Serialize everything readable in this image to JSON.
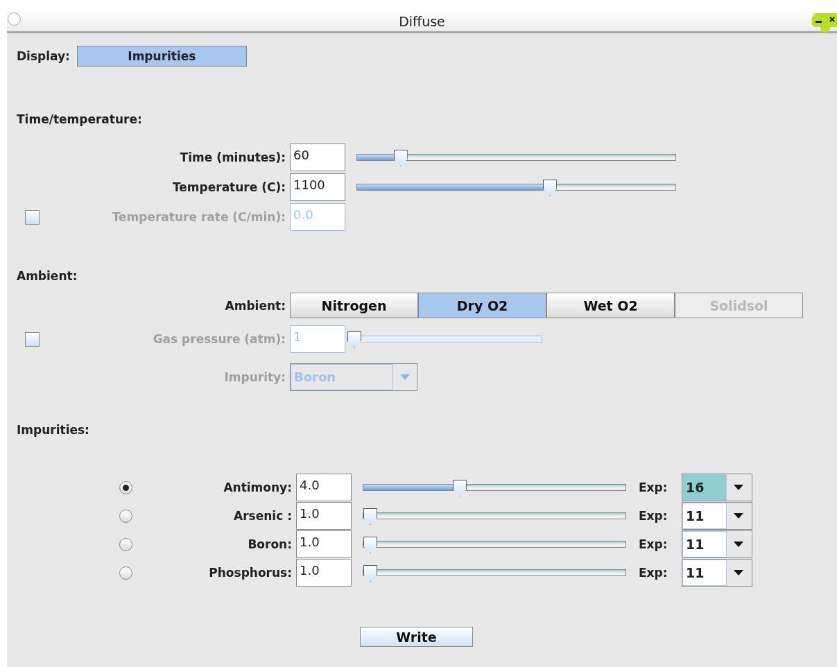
{
  "window": {
    "title": "Diffuse"
  },
  "display": {
    "label": "Display:",
    "value": "Impurities"
  },
  "time_temperature": {
    "heading": "Time/temperature:",
    "rows": [
      {
        "kind": "slider",
        "label": "Time (minutes):",
        "value": "60",
        "level": 0.12,
        "disabled": false
      },
      {
        "kind": "slider",
        "label": "Temperature (C):",
        "value": "1100",
        "level": 0.61,
        "disabled": false
      },
      {
        "kind": "checkbox",
        "label": "Temperature rate (C/min):",
        "value": "0.0",
        "checked": false,
        "disabled": true
      }
    ]
  },
  "ambient": {
    "heading": "Ambient:",
    "label": "Ambient:",
    "options": [
      {
        "label": "Nitrogen",
        "selected": false,
        "disabled": false
      },
      {
        "label": "Dry O2",
        "selected": true,
        "disabled": false
      },
      {
        "label": "Wet O2",
        "selected": false,
        "disabled": false
      },
      {
        "label": "Solidsol",
        "selected": false,
        "disabled": true
      }
    ],
    "gas_pressure": {
      "label": "Gas pressure (atm):",
      "value": "1",
      "level": 0,
      "checked": false,
      "disabled": true
    },
    "impurity": {
      "label": "Impurity:",
      "value": "Boron",
      "disabled": true
    }
  },
  "impurities": {
    "heading": "Impurities:",
    "rows": [
      {
        "label": "Antimony:",
        "value": "4.0",
        "level": 0.36,
        "selected": true,
        "exp_label": "Exp:",
        "exp": "16",
        "exp_focused": true
      },
      {
        "label": "Arsenic :",
        "value": "1.0",
        "level": 0,
        "selected": false,
        "exp_label": "Exp:",
        "exp": "11",
        "exp_focused": false
      },
      {
        "label": "Boron:",
        "value": "1.0",
        "level": 0,
        "selected": false,
        "exp_label": "Exp:",
        "exp": "11",
        "exp_focused": false
      },
      {
        "label": "Phosphorus:",
        "value": "1.0",
        "level": 0,
        "selected": false,
        "exp_label": "Exp:",
        "exp": "11",
        "exp_focused": false
      }
    ]
  },
  "buttons": [
    "Write"
  ]
}
